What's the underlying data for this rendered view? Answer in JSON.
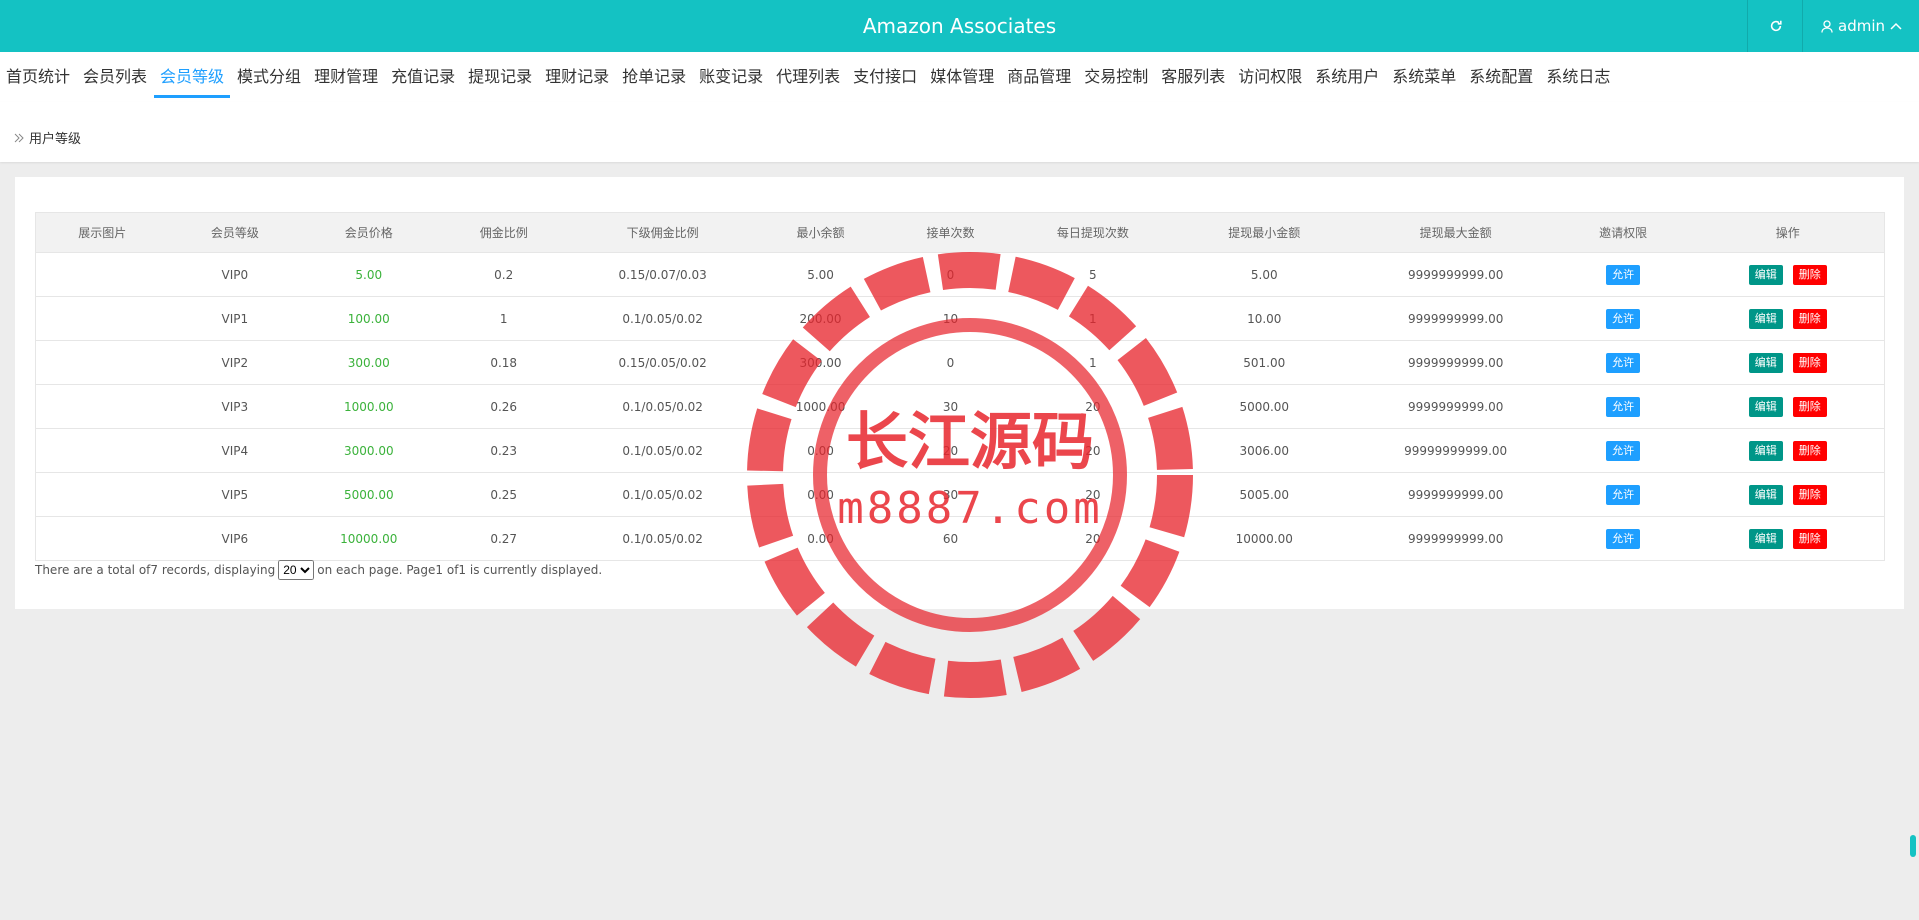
{
  "header": {
    "title": "Amazon Associates",
    "user": "admin",
    "accent_color": "#14c2c3"
  },
  "nav": [
    {
      "label": "首页统计",
      "active": false
    },
    {
      "label": "会员列表",
      "active": false
    },
    {
      "label": "会员等级",
      "active": true
    },
    {
      "label": "模式分组",
      "active": false
    },
    {
      "label": "理财管理",
      "active": false
    },
    {
      "label": "充值记录",
      "active": false
    },
    {
      "label": "提现记录",
      "active": false
    },
    {
      "label": "理财记录",
      "active": false
    },
    {
      "label": "抢单记录",
      "active": false
    },
    {
      "label": "账变记录",
      "active": false
    },
    {
      "label": "代理列表",
      "active": false
    },
    {
      "label": "支付接口",
      "active": false
    },
    {
      "label": "媒体管理",
      "active": false
    },
    {
      "label": "商品管理",
      "active": false
    },
    {
      "label": "交易控制",
      "active": false
    },
    {
      "label": "客服列表",
      "active": false
    },
    {
      "label": "访问权限",
      "active": false
    },
    {
      "label": "系统用户",
      "active": false
    },
    {
      "label": "系统菜单",
      "active": false
    },
    {
      "label": "系统配置",
      "active": false
    },
    {
      "label": "系统日志",
      "active": false
    }
  ],
  "breadcrumb": "用户等级",
  "table": {
    "columns": [
      "展示图片",
      "会员等级",
      "会员价格",
      "佣金比例",
      "下级佣金比例",
      "最小余额",
      "接单次数",
      "每日提现次数",
      "提现最小金额",
      "提现最大金额",
      "邀请权限",
      "操作"
    ],
    "allow_label": "允许",
    "edit_label": "编辑",
    "delete_label": "删除",
    "rows": [
      {
        "level": "VIP0",
        "price": "5.00",
        "commission": "0.2",
        "sub_commission": "0.15/0.07/0.03",
        "min_balance": "5.00",
        "orders": "0",
        "daily_withdraw": "5",
        "withdraw_min": "5.00",
        "withdraw_max": "9999999999.00"
      },
      {
        "level": "VIP1",
        "price": "100.00",
        "commission": "1",
        "sub_commission": "0.1/0.05/0.02",
        "min_balance": "200.00",
        "orders": "10",
        "daily_withdraw": "1",
        "withdraw_min": "10.00",
        "withdraw_max": "9999999999.00"
      },
      {
        "level": "VIP2",
        "price": "300.00",
        "commission": "0.18",
        "sub_commission": "0.15/0.05/0.02",
        "min_balance": "300.00",
        "orders": "0",
        "daily_withdraw": "1",
        "withdraw_min": "501.00",
        "withdraw_max": "9999999999.00"
      },
      {
        "level": "VIP3",
        "price": "1000.00",
        "commission": "0.26",
        "sub_commission": "0.1/0.05/0.02",
        "min_balance": "1000.00",
        "orders": "30",
        "daily_withdraw": "20",
        "withdraw_min": "5000.00",
        "withdraw_max": "9999999999.00"
      },
      {
        "level": "VIP4",
        "price": "3000.00",
        "commission": "0.23",
        "sub_commission": "0.1/0.05/0.02",
        "min_balance": "0.00",
        "orders": "20",
        "daily_withdraw": "20",
        "withdraw_min": "3006.00",
        "withdraw_max": "99999999999.00"
      },
      {
        "level": "VIP5",
        "price": "5000.00",
        "commission": "0.25",
        "sub_commission": "0.1/0.05/0.02",
        "min_balance": "0.00",
        "orders": "30",
        "daily_withdraw": "20",
        "withdraw_min": "5005.00",
        "withdraw_max": "9999999999.00"
      },
      {
        "level": "VIP6",
        "price": "10000.00",
        "commission": "0.27",
        "sub_commission": "0.1/0.05/0.02",
        "min_balance": "0.00",
        "orders": "60",
        "daily_withdraw": "20",
        "withdraw_min": "10000.00",
        "withdraw_max": "9999999999.00"
      }
    ]
  },
  "pager": {
    "prefix": "There are a total of7 records, displaying",
    "page_size": "20",
    "suffix": "on each page. Page1 of1 is currently displayed."
  },
  "watermark": {
    "text_cn": "长江源码",
    "text_url": "m8887.com",
    "color": "#e8262d"
  }
}
